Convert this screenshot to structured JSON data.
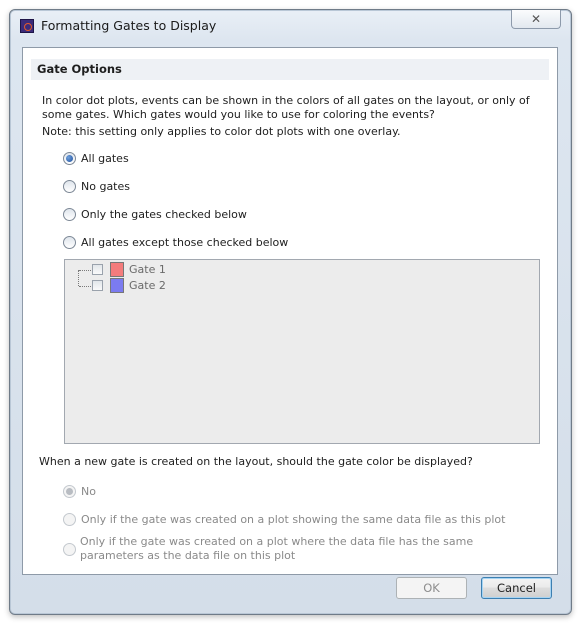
{
  "window": {
    "title": "Formatting Gates to Display",
    "close_glyph": "✕"
  },
  "group": {
    "header": "Gate Options",
    "description": "In color dot plots, events can be shown in the colors of all gates on the layout, or only of some gates. Which gates would you like to use for coloring the events?",
    "note": "Note: this setting only applies to color dot plots with one overlay."
  },
  "gate_options": [
    {
      "label": "All gates",
      "selected": true
    },
    {
      "label": "No gates",
      "selected": false
    },
    {
      "label": "Only the gates checked below",
      "selected": false
    },
    {
      "label": "All gates except those checked below",
      "selected": false
    }
  ],
  "gates": [
    {
      "label": "Gate 1",
      "color": "#f47c7c",
      "checked": false
    },
    {
      "label": "Gate 2",
      "color": "#7b7bf0",
      "checked": false
    }
  ],
  "new_gate": {
    "question": "When a new gate is created on the layout, should the gate color be displayed?",
    "options": [
      {
        "label": "No",
        "selected": true,
        "enabled": false
      },
      {
        "label": "Only if the gate was created on a plot showing the same data file as this plot",
        "selected": false,
        "enabled": false
      },
      {
        "label": "Only if the gate was created on a plot where the data file has the same parameters as the data file on this plot",
        "selected": false,
        "enabled": false
      }
    ]
  },
  "buttons": {
    "ok": "OK",
    "cancel": "Cancel"
  }
}
